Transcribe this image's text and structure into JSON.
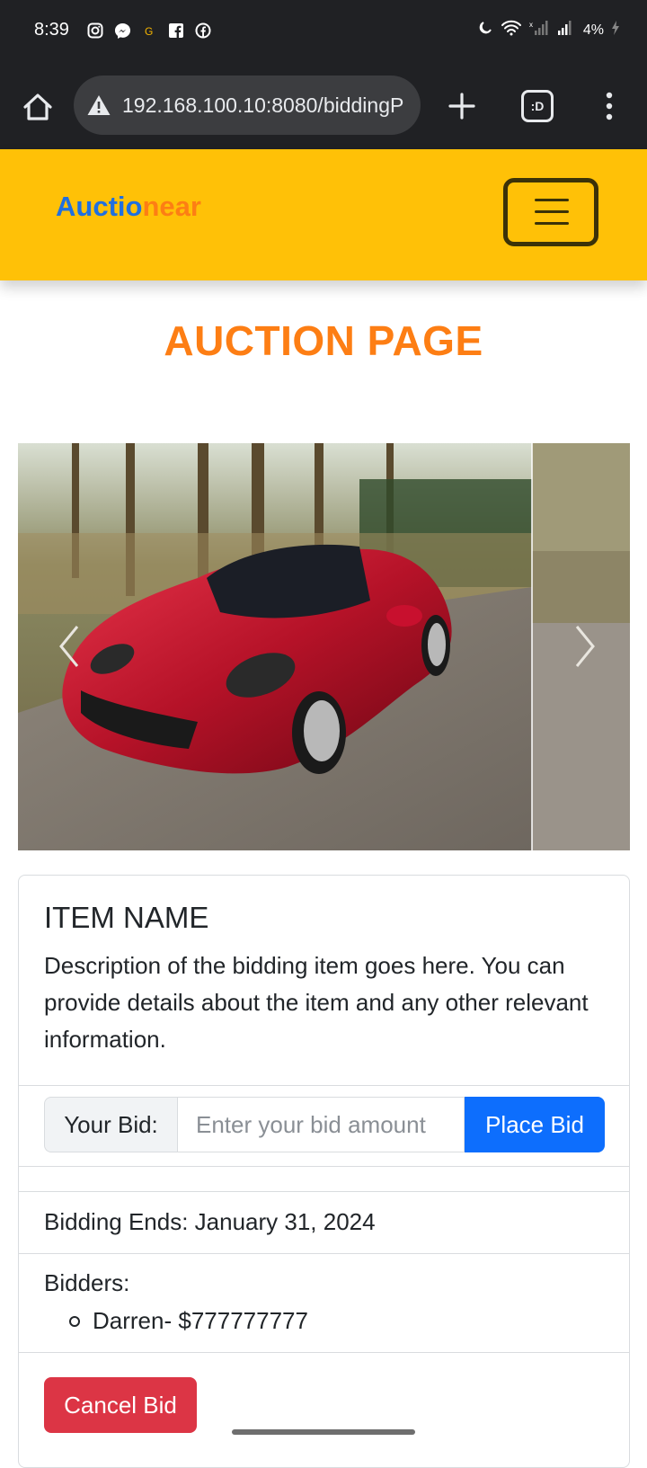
{
  "status_bar": {
    "time": "8:39",
    "notification_icons": [
      "instagram-icon",
      "messenger-icon",
      "google-icon",
      "facebook-square-icon",
      "facebook-icon"
    ],
    "battery": "4%"
  },
  "browser": {
    "url": "192.168.100.10:8080/biddingP"
  },
  "navbar": {
    "brand_part1": "Auctio",
    "brand_part2": "near",
    "brand_color1": "#1f6fe0",
    "brand_color2": "#fd7e14",
    "bg_color": "#ffc107"
  },
  "page": {
    "title": "AUCTION PAGE"
  },
  "item": {
    "name": "ITEM NAME",
    "description": "Description of the bidding item goes here. You can provide details about the item and any other relevant information."
  },
  "bid_form": {
    "label": "Your Bid:",
    "placeholder": "Enter your bid amount",
    "button": "Place Bid"
  },
  "bidding": {
    "ends": "Bidding Ends: January 31, 2024",
    "bidders_label": "Bidders:",
    "bidders": [
      "Darren- $777777777"
    ]
  },
  "actions": {
    "cancel": "Cancel Bid"
  }
}
